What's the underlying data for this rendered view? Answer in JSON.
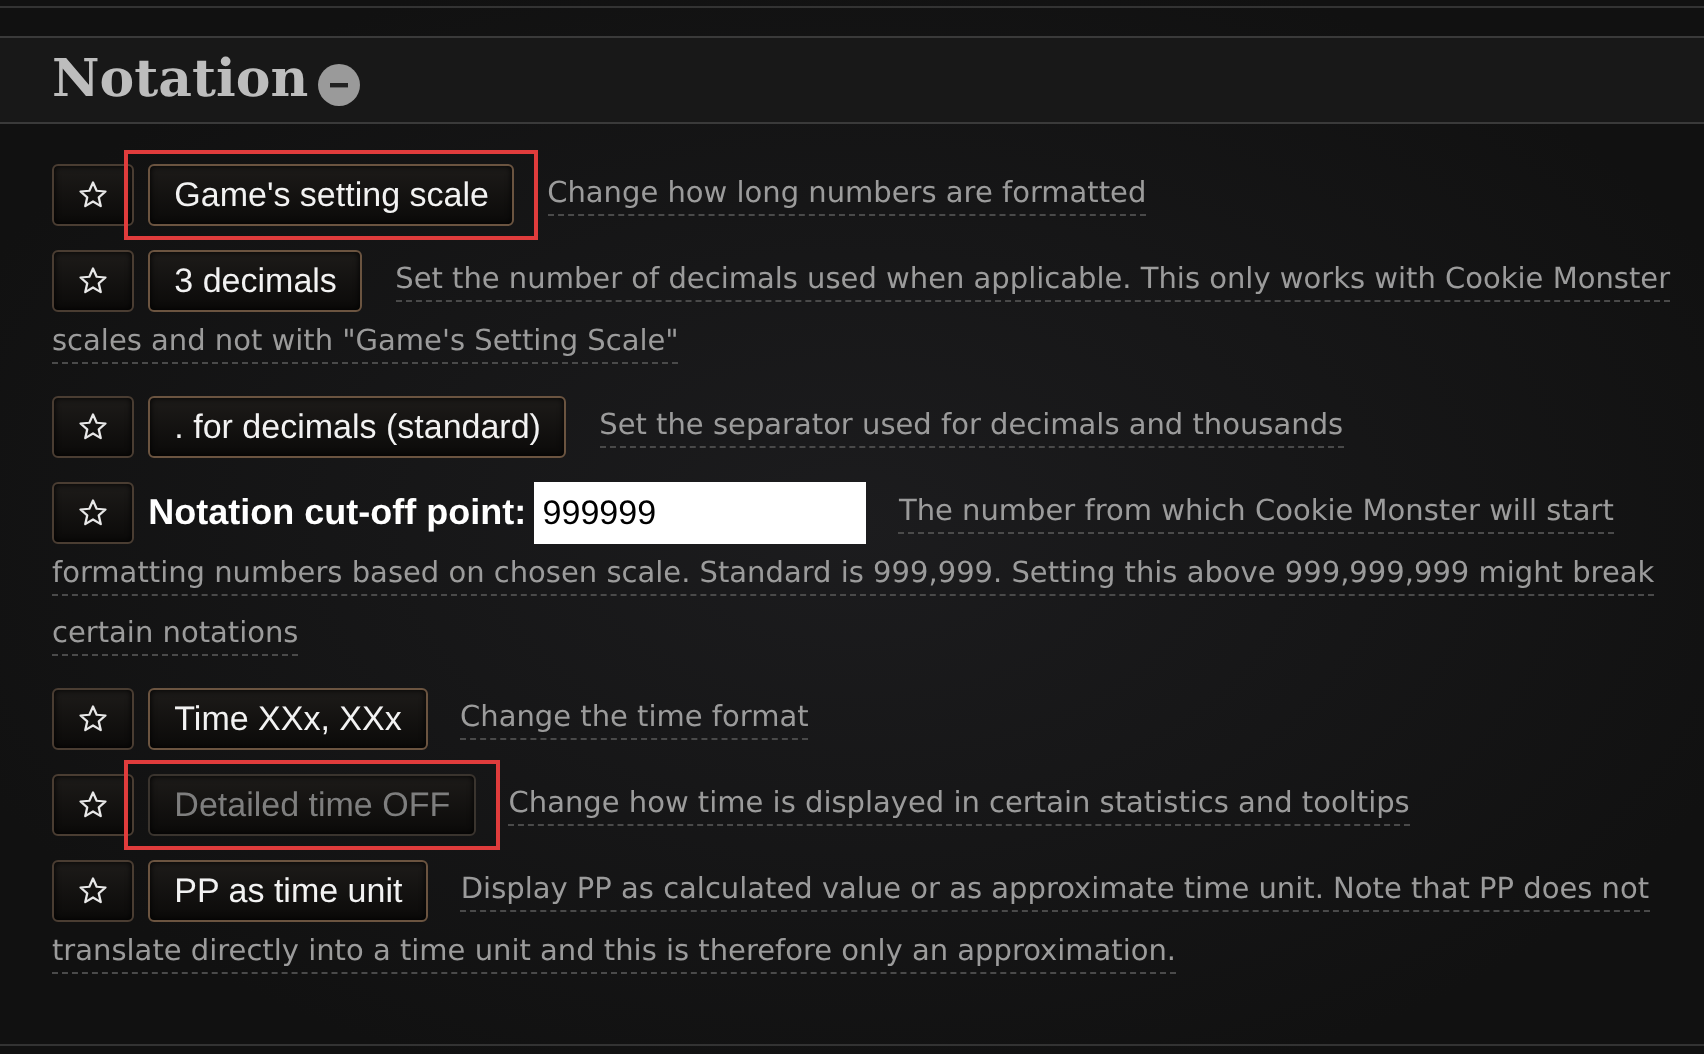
{
  "section": {
    "title": "Notation",
    "expanded": true
  },
  "settings": [
    {
      "kind": "button",
      "favorite": false,
      "label": "Game's setting scale",
      "enabled": true,
      "highlighted": true,
      "description": "Change how long numbers are formatted"
    },
    {
      "kind": "button",
      "favorite": false,
      "label": "3 decimals",
      "enabled": true,
      "highlighted": false,
      "description": "Set the number of decimals used when applicable. This only works with Cookie Monster scales and not with \"Game's Setting Scale\""
    },
    {
      "kind": "button",
      "favorite": false,
      "label": ". for decimals (standard)",
      "enabled": true,
      "highlighted": false,
      "description": "Set the separator used for decimals and thousands"
    },
    {
      "kind": "input",
      "favorite": false,
      "label": "Notation cut-off point:",
      "value": "999999",
      "description": "The number from which Cookie Monster will start formatting numbers based on chosen scale. Standard is 999,999. Setting this above 999,999,999 might break certain notations"
    },
    {
      "kind": "button",
      "favorite": false,
      "label": "Time XXx, XXx",
      "enabled": true,
      "highlighted": false,
      "description": "Change the time format"
    },
    {
      "kind": "button",
      "favorite": false,
      "label": "Detailed time OFF",
      "enabled": false,
      "highlighted": true,
      "description": "Change how time is displayed in certain statistics and tooltips"
    },
    {
      "kind": "button",
      "favorite": false,
      "label": "PP as time unit",
      "enabled": true,
      "highlighted": false,
      "description": "Display PP as calculated value or as approximate time unit. Note that PP does not translate directly into a time unit and this is therefore only an approximation."
    }
  ]
}
